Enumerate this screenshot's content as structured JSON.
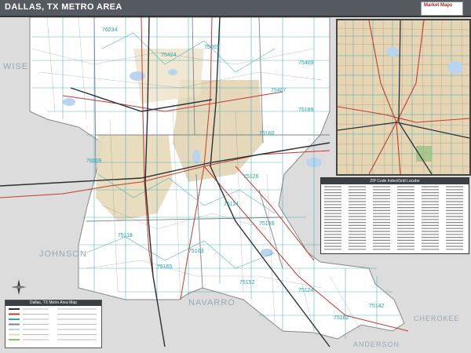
{
  "title": "DALLAS, TX METRO AREA",
  "publisher": {
    "line1": "Market Maps",
    "line2": ""
  },
  "counties": [
    {
      "name": "WISE"
    },
    {
      "name": "JOHNSON"
    },
    {
      "name": "NAVARRO"
    },
    {
      "name": "ANDERSON"
    },
    {
      "name": "CHEROKEE"
    }
  ],
  "zip_labels": [
    "76234",
    "75009",
    "75409",
    "75424",
    "75407",
    "75189",
    "75160",
    "75126",
    "75114",
    "75159",
    "75118",
    "76009",
    "75165",
    "75152",
    "75103",
    "75124",
    "75162",
    "75142"
  ],
  "index_title": "ZIP Code Index/Grid Locator",
  "legend_title": "Dallas, TX Metro Area Map",
  "colors": {
    "water": "#b8d4ee",
    "urban": "#d9c9a6",
    "background": "#dcdcdc",
    "county_fill": "#ffffff",
    "zip_boundary": "#2aa7b2",
    "highway": "#2a2f36",
    "major_road": "#c23b2f"
  }
}
